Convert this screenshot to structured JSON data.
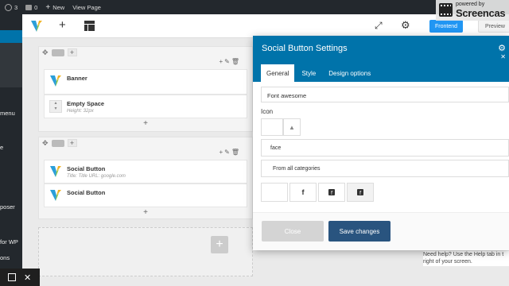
{
  "adminbar": {
    "updates_count": "3",
    "comments_count": "0",
    "new_label": "New",
    "view_page_label": "View Page"
  },
  "watermark": {
    "powered": "powered by",
    "brand": "Screencas"
  },
  "sidebar": {
    "items": [
      "menu",
      "e",
      "poser",
      "for WP",
      "ons"
    ]
  },
  "toolbar": {
    "frontend_label": "Frontend",
    "preview_label": "Preview"
  },
  "canvas": {
    "row1": {
      "elements": [
        {
          "title": "Banner",
          "subtitle": ""
        },
        {
          "title": "Empty Space",
          "subtitle": "Height: 32px"
        }
      ]
    },
    "row2": {
      "elements": [
        {
          "title": "Social Button",
          "subtitle": "Title: Title  URL: google.com"
        },
        {
          "title": "Social Button",
          "subtitle": ""
        }
      ]
    }
  },
  "modal": {
    "title": "Social Button Settings",
    "tabs": [
      "General",
      "Style",
      "Design options"
    ],
    "active_tab": "General",
    "font_select_value": "Font awesome",
    "icon_label": "Icon",
    "search_value": "face",
    "category_value": "From all categories",
    "icons": [
      "f",
      "facebook-square",
      "facebook-official"
    ],
    "close_label": "Close",
    "save_label": "Save changes"
  },
  "help_text": "Need help? Use the Help tab in t right of your screen.",
  "colors": {
    "admin_bar": "#23282d",
    "modal_header": "#0073aa",
    "save_button": "#29547f",
    "frontend_button": "#2196f3"
  }
}
